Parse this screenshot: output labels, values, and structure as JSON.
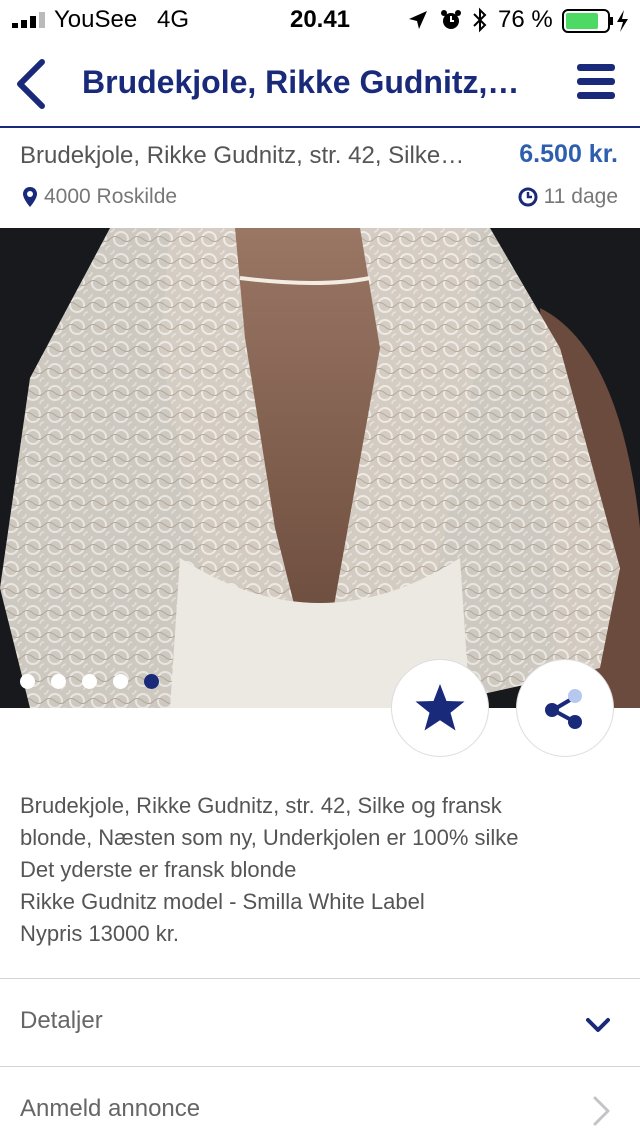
{
  "status_bar": {
    "carrier": "YouSee",
    "network": "4G",
    "time": "20.41",
    "battery": "76 %"
  },
  "nav": {
    "title": "Brudekjole, Rikke Gudnitz, str. 42, Silke og fransk blonde",
    "back_icon": "chevron-left-icon",
    "menu_icon": "hamburger-menu-icon"
  },
  "listing": {
    "title": "Brudekjole, Rikke Gudnitz, str. 42, Silke og fransk blonde",
    "price": "6.500 kr.",
    "location": "4000 Roskilde",
    "age": "11 dage"
  },
  "gallery": {
    "image_count": 5,
    "active_index": 4
  },
  "actions": {
    "favorite_icon": "star-icon",
    "share_icon": "share-icon"
  },
  "description": {
    "lines": [
      "Brudekjole, Rikke Gudnitz, str. 42, Silke og fransk",
      "blonde, Næsten som ny, Underkjolen er 100% silke",
      "Det yderste er fransk blonde",
      "Rikke Gudnitz model - Smilla White Label",
      "Nypris 13000 kr."
    ]
  },
  "sections": {
    "details_label": "Detaljer",
    "report_label": "Anmeld annonce"
  },
  "colors": {
    "brand_navy": "#1a2a7a",
    "price_blue": "#2e5fae",
    "battery_green": "#4cd964"
  }
}
